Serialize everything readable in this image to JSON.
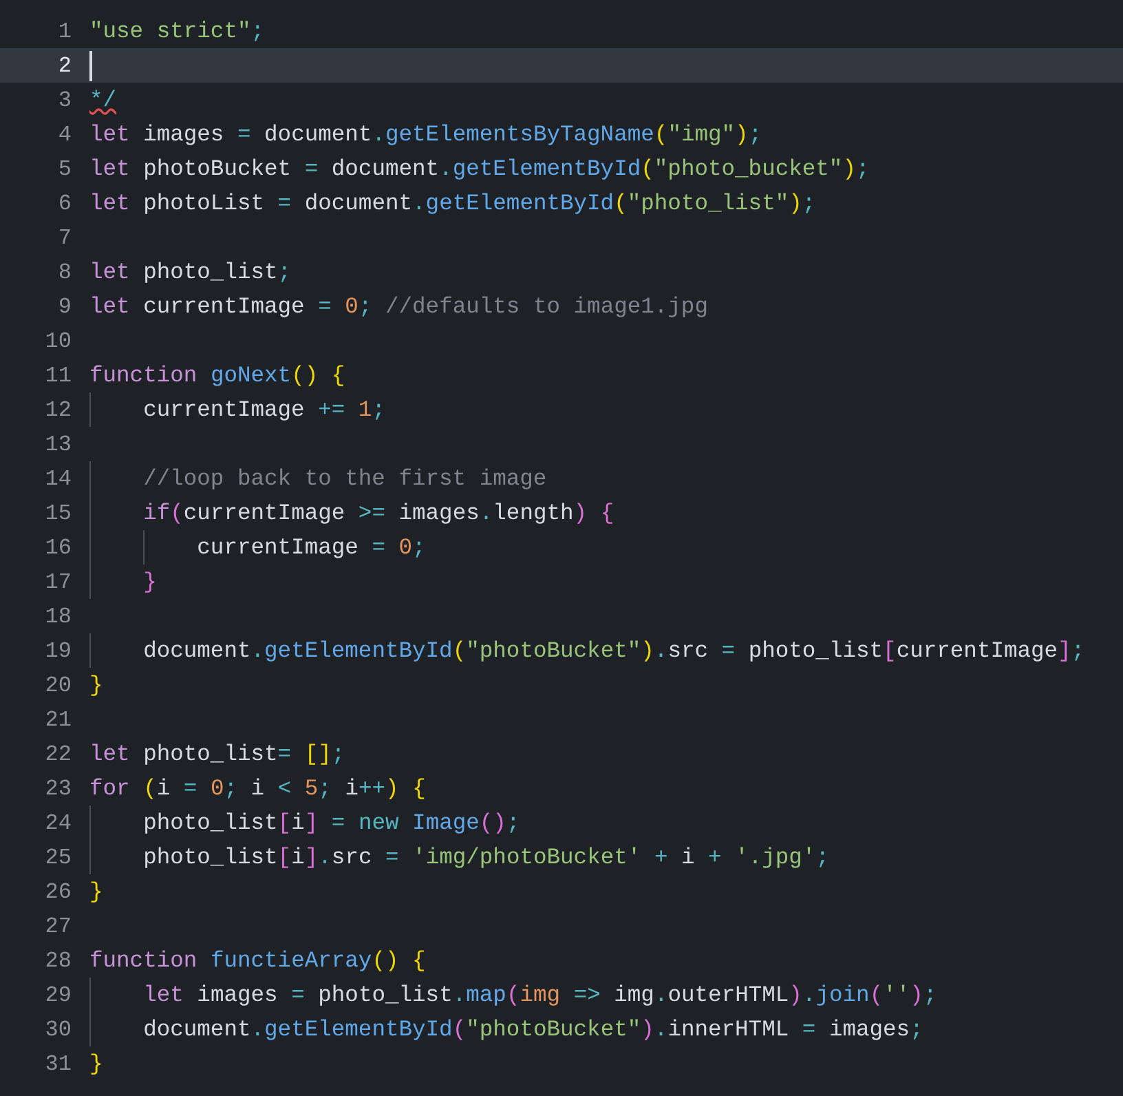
{
  "editor": {
    "lines": [
      {
        "n": "1",
        "selected": false,
        "tokens": [
          {
            "t": "\"use strict\"",
            "kind": "string"
          },
          {
            "t": ";",
            "kind": "operator"
          }
        ]
      },
      {
        "n": "2",
        "selected": true
      },
      {
        "n": "3",
        "selected": false,
        "tokens": [
          {
            "t": "*/",
            "kind": "error"
          }
        ]
      },
      {
        "n": "4",
        "selected": false,
        "tokens": [
          {
            "t": "let",
            "kind": "keyword"
          },
          {
            "t": " images ",
            "kind": "plain"
          },
          {
            "t": "=",
            "kind": "operator"
          },
          {
            "t": " document",
            "kind": "plain"
          },
          {
            "t": ".",
            "kind": "operator"
          },
          {
            "t": "getElementsByTagName",
            "kind": "function"
          },
          {
            "t": "(",
            "kind": "outer"
          },
          {
            "t": "\"img\"",
            "kind": "string"
          },
          {
            "t": ")",
            "kind": "outer"
          },
          {
            "t": ";",
            "kind": "operator"
          }
        ]
      },
      {
        "n": "5",
        "selected": false,
        "tokens": [
          {
            "t": "let",
            "kind": "keyword"
          },
          {
            "t": " photoBucket ",
            "kind": "plain"
          },
          {
            "t": "=",
            "kind": "operator"
          },
          {
            "t": " document",
            "kind": "plain"
          },
          {
            "t": ".",
            "kind": "operator"
          },
          {
            "t": "getElementById",
            "kind": "function"
          },
          {
            "t": "(",
            "kind": "outer"
          },
          {
            "t": "\"photo_bucket\"",
            "kind": "string"
          },
          {
            "t": ")",
            "kind": "outer"
          },
          {
            "t": ";",
            "kind": "operator"
          }
        ]
      },
      {
        "n": "6",
        "selected": false,
        "tokens": [
          {
            "t": "let",
            "kind": "keyword"
          },
          {
            "t": " photoList ",
            "kind": "plain"
          },
          {
            "t": "=",
            "kind": "operator"
          },
          {
            "t": " document",
            "kind": "plain"
          },
          {
            "t": ".",
            "kind": "operator"
          },
          {
            "t": "getElementById",
            "kind": "function"
          },
          {
            "t": "(",
            "kind": "outer"
          },
          {
            "t": "\"photo_list\"",
            "kind": "string"
          },
          {
            "t": ")",
            "kind": "outer"
          },
          {
            "t": ";",
            "kind": "operator"
          }
        ]
      },
      {
        "n": "7",
        "selected": false
      },
      {
        "n": "8",
        "selected": false,
        "tokens": [
          {
            "t": "let",
            "kind": "keyword"
          },
          {
            "t": " photo_list",
            "kind": "plain"
          },
          {
            "t": ";",
            "kind": "operator"
          }
        ]
      },
      {
        "n": "9",
        "selected": false,
        "tokens": [
          {
            "t": "let",
            "kind": "keyword"
          },
          {
            "t": " currentImage ",
            "kind": "plain"
          },
          {
            "t": "= ",
            "kind": "operator"
          },
          {
            "t": "0",
            "kind": "number"
          },
          {
            "t": ";",
            "kind": "operator"
          },
          {
            "t": " //defaults to image1.jpg",
            "kind": "comment"
          }
        ]
      },
      {
        "n": "10",
        "selected": false
      },
      {
        "n": "11",
        "selected": false,
        "tokens": [
          {
            "t": "function",
            "kind": "keyword"
          },
          {
            "t": " goNext",
            "kind": "function"
          },
          {
            "t": "() {",
            "kind": "outer"
          }
        ]
      },
      {
        "n": "12",
        "selected": false,
        "tokens": [
          {
            "t": "    currentImage ",
            "kind": "plain"
          },
          {
            "t": "+= ",
            "kind": "operator"
          },
          {
            "t": "1",
            "kind": "number"
          },
          {
            "t": ";",
            "kind": "operator"
          }
        ]
      },
      {
        "n": "13",
        "selected": false
      },
      {
        "n": "14",
        "selected": false,
        "tokens": [
          {
            "t": "    //loop back to the first image",
            "kind": "comment"
          }
        ]
      },
      {
        "n": "15",
        "selected": false,
        "tokens": [
          {
            "t": "    if",
            "kind": "keyword"
          },
          {
            "t": "(",
            "kind": "inner"
          },
          {
            "t": "currentImage ",
            "kind": "plain"
          },
          {
            "t": ">=",
            "kind": "operator"
          },
          {
            "t": " images",
            "kind": "plain"
          },
          {
            "t": ".",
            "kind": "operator"
          },
          {
            "t": "length",
            "kind": "plain"
          },
          {
            "t": ") {",
            "kind": "inner"
          }
        ]
      },
      {
        "n": "16",
        "selected": false,
        "tokens": [
          {
            "t": "        currentImage ",
            "kind": "plain"
          },
          {
            "t": "= ",
            "kind": "operator"
          },
          {
            "t": "0",
            "kind": "number"
          },
          {
            "t": ";",
            "kind": "operator"
          }
        ]
      },
      {
        "n": "17",
        "selected": false,
        "tokens": [
          {
            "t": "    }",
            "kind": "inner"
          }
        ]
      },
      {
        "n": "18",
        "selected": false
      },
      {
        "n": "19",
        "selected": false,
        "tokens": [
          {
            "t": "    document",
            "kind": "plain"
          },
          {
            "t": ".",
            "kind": "operator"
          },
          {
            "t": "getElementById",
            "kind": "function"
          },
          {
            "t": "(",
            "kind": "outer"
          },
          {
            "t": "\"photoBucket\"",
            "kind": "string"
          },
          {
            "t": ")",
            "kind": "outer"
          },
          {
            "t": ".",
            "kind": "operator"
          },
          {
            "t": "src ",
            "kind": "plain"
          },
          {
            "t": "=",
            "kind": "operator"
          },
          {
            "t": " photo_list",
            "kind": "plain"
          },
          {
            "t": "[",
            "kind": "inner"
          },
          {
            "t": "currentImage",
            "kind": "plain"
          },
          {
            "t": "]",
            "kind": "inner"
          },
          {
            "t": ";",
            "kind": "operator"
          }
        ]
      },
      {
        "n": "20",
        "selected": false,
        "tokens": [
          {
            "t": "}",
            "kind": "outer"
          }
        ]
      },
      {
        "n": "21",
        "selected": false
      },
      {
        "n": "22",
        "selected": false,
        "tokens": [
          {
            "t": "let",
            "kind": "keyword"
          },
          {
            "t": " photo_list",
            "kind": "plain"
          },
          {
            "t": "= ",
            "kind": "operator"
          },
          {
            "t": "[]",
            "kind": "outer"
          },
          {
            "t": ";",
            "kind": "operator"
          }
        ]
      },
      {
        "n": "23",
        "selected": false,
        "tokens": [
          {
            "t": "for",
            "kind": "keyword"
          },
          {
            "t": " (",
            "kind": "outer"
          },
          {
            "t": "i ",
            "kind": "plain"
          },
          {
            "t": "= ",
            "kind": "operator"
          },
          {
            "t": "0",
            "kind": "number"
          },
          {
            "t": ";",
            "kind": "operator"
          },
          {
            "t": " i ",
            "kind": "plain"
          },
          {
            "t": "< ",
            "kind": "operator"
          },
          {
            "t": "5",
            "kind": "number"
          },
          {
            "t": ";",
            "kind": "operator"
          },
          {
            "t": " i",
            "kind": "plain"
          },
          {
            "t": "++",
            "kind": "operator"
          },
          {
            "t": ") {",
            "kind": "outer"
          }
        ]
      },
      {
        "n": "24",
        "selected": false,
        "tokens": [
          {
            "t": "    photo_list",
            "kind": "plain"
          },
          {
            "t": "[",
            "kind": "inner"
          },
          {
            "t": "i",
            "kind": "plain"
          },
          {
            "t": "]",
            "kind": "inner"
          },
          {
            "t": " = new ",
            "kind": "operator"
          },
          {
            "t": "Image",
            "kind": "function"
          },
          {
            "t": "()",
            "kind": "inner"
          },
          {
            "t": ";",
            "kind": "operator"
          }
        ]
      },
      {
        "n": "25",
        "selected": false,
        "tokens": [
          {
            "t": "    photo_list",
            "kind": "plain"
          },
          {
            "t": "[",
            "kind": "inner"
          },
          {
            "t": "i",
            "kind": "plain"
          },
          {
            "t": "]",
            "kind": "inner"
          },
          {
            "t": ".",
            "kind": "operator"
          },
          {
            "t": "src ",
            "kind": "plain"
          },
          {
            "t": "= ",
            "kind": "operator"
          },
          {
            "t": "'img/photoBucket' ",
            "kind": "string"
          },
          {
            "t": "+",
            "kind": "operator"
          },
          {
            "t": " i ",
            "kind": "plain"
          },
          {
            "t": "+ ",
            "kind": "operator"
          },
          {
            "t": "'.jpg'",
            "kind": "string"
          },
          {
            "t": ";",
            "kind": "operator"
          }
        ]
      },
      {
        "n": "26",
        "selected": false,
        "tokens": [
          {
            "t": "}",
            "kind": "outer"
          }
        ]
      },
      {
        "n": "27",
        "selected": false
      },
      {
        "n": "28",
        "selected": false,
        "tokens": [
          {
            "t": "function",
            "kind": "keyword"
          },
          {
            "t": " functieArray",
            "kind": "function"
          },
          {
            "t": "() {",
            "kind": "outer"
          }
        ]
      },
      {
        "n": "29",
        "selected": false,
        "tokens": [
          {
            "t": "    let",
            "kind": "keyword"
          },
          {
            "t": " images ",
            "kind": "plain"
          },
          {
            "t": "=",
            "kind": "operator"
          },
          {
            "t": " photo_list",
            "kind": "plain"
          },
          {
            "t": ".",
            "kind": "operator"
          },
          {
            "t": "map",
            "kind": "function"
          },
          {
            "t": "(",
            "kind": "inner"
          },
          {
            "t": "img ",
            "kind": "number"
          },
          {
            "t": "=>",
            "kind": "operator"
          },
          {
            "t": " img",
            "kind": "plain"
          },
          {
            "t": ".",
            "kind": "operator"
          },
          {
            "t": "outerHTML",
            "kind": "plain"
          },
          {
            "t": ")",
            "kind": "inner"
          },
          {
            "t": ".",
            "kind": "operator"
          },
          {
            "t": "join",
            "kind": "function"
          },
          {
            "t": "(",
            "kind": "inner"
          },
          {
            "t": "''",
            "kind": "string"
          },
          {
            "t": ")",
            "kind": "inner"
          },
          {
            "t": ";",
            "kind": "operator"
          }
        ]
      },
      {
        "n": "30",
        "selected": false,
        "tokens": [
          {
            "t": "    document",
            "kind": "plain"
          },
          {
            "t": ".",
            "kind": "operator"
          },
          {
            "t": "getElementById",
            "kind": "function"
          },
          {
            "t": "(",
            "kind": "inner"
          },
          {
            "t": "\"photoBucket\"",
            "kind": "string"
          },
          {
            "t": ")",
            "kind": "inner"
          },
          {
            "t": ".",
            "kind": "operator"
          },
          {
            "t": "innerHTML ",
            "kind": "plain"
          },
          {
            "t": "=",
            "kind": "operator"
          },
          {
            "t": " images",
            "kind": "plain"
          },
          {
            "t": ";",
            "kind": "operator"
          }
        ]
      },
      {
        "n": "31",
        "selected": false,
        "tokens": [
          {
            "t": "}",
            "kind": "outer"
          }
        ]
      }
    ]
  }
}
